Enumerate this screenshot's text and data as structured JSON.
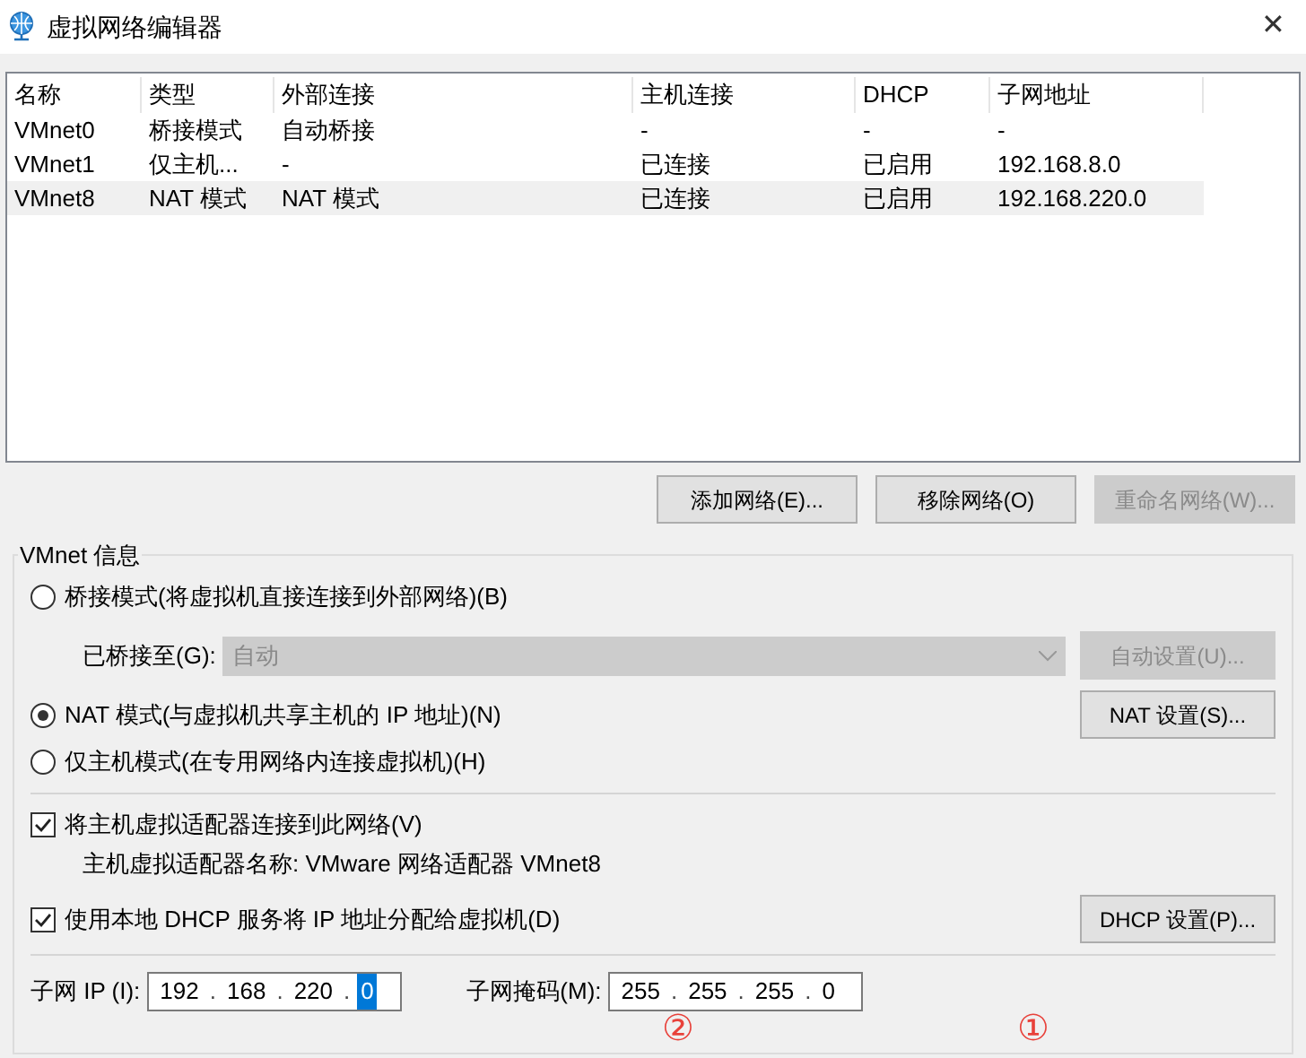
{
  "window": {
    "title": "虚拟网络编辑器",
    "close": "✕"
  },
  "table": {
    "columns": [
      "名称",
      "类型",
      "外部连接",
      "主机连接",
      "DHCP",
      "子网地址"
    ],
    "rows": [
      {
        "cells": [
          "VMnet0",
          "桥接模式",
          "自动桥接",
          "-",
          "-",
          "-"
        ],
        "selected": false
      },
      {
        "cells": [
          "VMnet1",
          "仅主机...",
          "-",
          "已连接",
          "已启用",
          "192.168.8.0"
        ],
        "selected": false
      },
      {
        "cells": [
          "VMnet8",
          "NAT 模式",
          "NAT 模式",
          "已连接",
          "已启用",
          "192.168.220.0"
        ],
        "selected": true
      }
    ]
  },
  "table_buttons": [
    {
      "label": "添加网络(E)...",
      "disabled": false
    },
    {
      "label": "移除网络(O)",
      "disabled": false
    },
    {
      "label": "重命名网络(W)...",
      "disabled": true
    }
  ],
  "group": {
    "title": "VMnet 信息",
    "modes": [
      {
        "label": "桥接模式(将虚拟机直接连接到外部网络)(B)",
        "selected": false
      },
      {
        "label": "NAT 模式(与虚拟机共享主机的 IP 地址)(N)",
        "selected": true
      },
      {
        "label": "仅主机模式(在专用网络内连接虚拟机)(H)",
        "selected": false
      }
    ],
    "bridged": {
      "label": "已桥接至(G):",
      "value": "自动",
      "disabled": true,
      "button": "自动设置(U)..."
    },
    "nat_button": "NAT 设置(S)...",
    "connect_adapter": {
      "label": "将主机虚拟适配器连接到此网络(V)",
      "checked": true
    },
    "adapter_name": "主机虚拟适配器名称: VMware 网络适配器 VMnet8",
    "dhcp": {
      "label": "使用本地 DHCP 服务将 IP 地址分配给虚拟机(D)",
      "checked": true,
      "button": "DHCP 设置(P)..."
    },
    "subnet_ip": {
      "label": "子网 IP (I):",
      "octets": [
        "192",
        "168",
        "220",
        "0"
      ],
      "separator": "."
    },
    "subnet_mask": {
      "label": "子网掩码(M):",
      "octets": [
        "255",
        "255",
        "255",
        "0"
      ],
      "separator": "."
    }
  },
  "annotations": [
    "②",
    "①"
  ]
}
